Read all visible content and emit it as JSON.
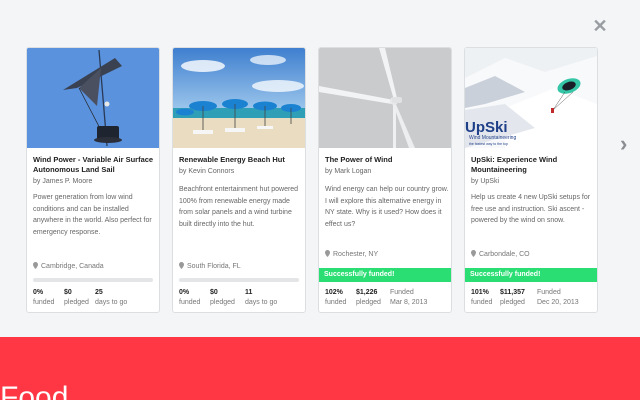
{
  "close_icon": "✕",
  "next_icon": "›",
  "cards": [
    {
      "title": "Wind Power - Variable Air Surface Autonomous Land Sail",
      "author": "by James P. Moore",
      "blurb": "Power generation from low wind conditions and can be installed anywhere in the world. Also perfect for emergency response.",
      "location": "Cambridge, Canada",
      "progress_percent": 0,
      "funded_state": "",
      "stats": [
        {
          "value": "0%",
          "label": "funded"
        },
        {
          "value": "$0",
          "label": "pledged"
        },
        {
          "value": "25",
          "label": "days to go"
        }
      ]
    },
    {
      "title": "Renewable Energy Beach Hut",
      "author": "by Kevin Connors",
      "blurb": "Beachfront entertainment hut powered 100% from renewable energy made from solar panels and a wind turbine built directly into the hut.",
      "location": "South Florida, FL",
      "progress_percent": 0,
      "funded_state": "",
      "stats": [
        {
          "value": "0%",
          "label": "funded"
        },
        {
          "value": "$0",
          "label": "pledged"
        },
        {
          "value": "11",
          "label": "days to go"
        }
      ]
    },
    {
      "title": "The Power of Wind",
      "author": "by Mark Logan",
      "blurb": "Wind energy can help our country grow. I will explore this alternative energy in NY state. Why is it used? How does it effect us?",
      "location": "Rochester, NY",
      "progress_percent": 102,
      "funded_state": "Successfully funded!",
      "stats": [
        {
          "value": "102%",
          "label": "funded"
        },
        {
          "value": "$1,226",
          "label": "pledged"
        },
        {
          "value": "Funded",
          "label": "Mar 8, 2013"
        }
      ]
    },
    {
      "title": "UpSki: Experience Wind Mountaineering",
      "author": "by UpSki",
      "blurb": "Help us create 4 new UpSki setups for free use and instruction. Ski ascent - powered by the wind on snow.",
      "location": "Carbondale, CO",
      "progress_percent": 101,
      "funded_state": "Successfully funded!",
      "stats": [
        {
          "value": "101%",
          "label": "funded"
        },
        {
          "value": "$11,357",
          "label": "pledged"
        },
        {
          "value": "Funded",
          "label": "Dec 20, 2013"
        }
      ],
      "thumb_logo": "UpSki",
      "thumb_logo_sub": "Wind Mountaineering",
      "thumb_logo_tag": "the fastest way to the top"
    }
  ],
  "banner": {
    "text": "Food",
    "color": "#ff3744"
  },
  "colors": {
    "funded_green": "#2bde73",
    "overlay_bg": "#f4f5f6"
  }
}
